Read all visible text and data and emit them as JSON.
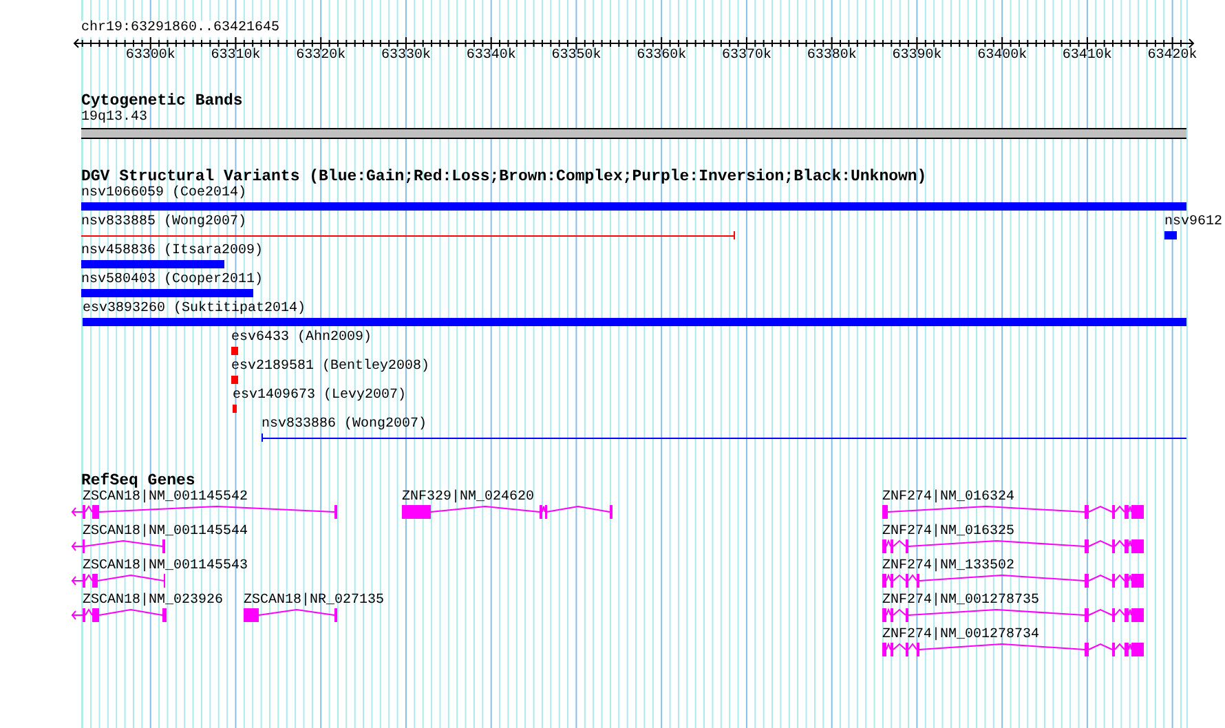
{
  "ruler": {
    "title": "chr19:63291860..63421645",
    "ticks": [
      "63300k",
      "63310k",
      "63320k",
      "63330k",
      "63340k",
      "63350k",
      "63360k",
      "63370k",
      "63380k",
      "63390k",
      "63400k",
      "63410k",
      "63420k"
    ]
  },
  "cytogenetic_bands": {
    "title": "Cytogenetic Bands",
    "band": "19q13.43"
  },
  "structural_variants": {
    "title": "DGV Structural Variants (Blue:Gain;Red:Loss;Brown:Complex;Purple:Inversion;Black:Unknown)",
    "features": [
      {
        "label": "nsv1066059 (Coe2014)",
        "color": "#0000ff",
        "kind": "bar"
      },
      {
        "label": "nsv833885 (Wong2007)",
        "color": "#ff0000",
        "kind": "line"
      },
      {
        "label": "nsv9612",
        "color": "#0000ff",
        "kind": "bar"
      },
      {
        "label": "nsv458836 (Itsara2009)",
        "color": "#0000ff",
        "kind": "bar"
      },
      {
        "label": "nsv580403 (Cooper2011)",
        "color": "#0000ff",
        "kind": "bar"
      },
      {
        "label": "esv3893260 (Suktitipat2014)",
        "color": "#0000ff",
        "kind": "bar"
      },
      {
        "label": "esv6433 (Ahn2009)",
        "color": "#ff0000",
        "kind": "bar"
      },
      {
        "label": "esv2189581 (Bentley2008)",
        "color": "#ff0000",
        "kind": "bar"
      },
      {
        "label": "esv1409673 (Levy2007)",
        "color": "#ff0000",
        "kind": "bar"
      },
      {
        "label": "nsv833886 (Wong2007)",
        "color": "#0000ff",
        "kind": "line"
      }
    ]
  },
  "refseq_genes": {
    "title": "RefSeq Genes",
    "genes": [
      {
        "label": "ZSCAN18|NM_001145542"
      },
      {
        "label": "ZNF329|NM_024620"
      },
      {
        "label": "ZSCAN18|NM_001145544"
      },
      {
        "label": "ZSCAN18|NM_001145543"
      },
      {
        "label": "ZSCAN18|NM_023926"
      },
      {
        "label": "ZSCAN18|NR_027135"
      },
      {
        "label": "ZNF274|NM_016324"
      },
      {
        "label": "ZNF274|NM_016325"
      },
      {
        "label": "ZNF274|NM_133502"
      },
      {
        "label": "ZNF274|NM_001278735"
      },
      {
        "label": "ZNF274|NM_001278734"
      }
    ]
  }
}
